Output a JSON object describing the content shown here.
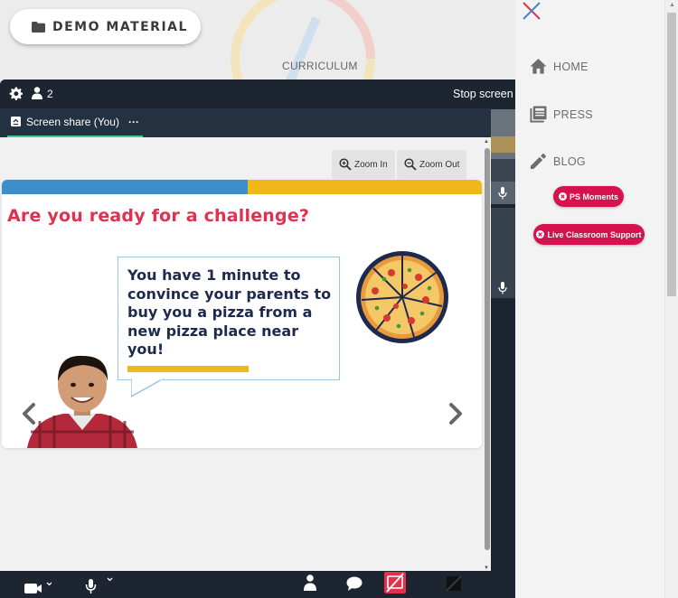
{
  "header": {
    "demo_button_label": "DEMO MATERIAL",
    "section_title": "CURRICULUM",
    "logo_colors": [
      "#f2b71b",
      "#e0314f",
      "#3b8fcb"
    ]
  },
  "meeting": {
    "participant_count": "2",
    "stop_share_label": "Stop screen",
    "tab_label": "Screen share (You)",
    "tab_more": "···",
    "zoom_in_label": "Zoom In",
    "zoom_out_label": "Zoom Out",
    "slide": {
      "title": "Are you ready for a challenge?",
      "bubble_text": "You have 1 minute to convince your parents to buy you a pizza from a new pizza place near you!",
      "colors": {
        "blue": "#3b8fcb",
        "yellow": "#f2b71b",
        "title": "#e0314f",
        "text": "#1d2a4e"
      }
    },
    "bottom_icons": [
      "camera-icon",
      "microphone-icon",
      "participants-icon",
      "chat-icon",
      "share-screen-off-icon",
      "more-icon"
    ]
  },
  "panel": {
    "nav": [
      {
        "label": "HOME",
        "icon": "home-icon"
      },
      {
        "label": "PRESS",
        "icon": "press-icon"
      },
      {
        "label": "BLOG",
        "icon": "pencil-icon"
      }
    ],
    "pills": [
      {
        "label": "PS Moments"
      },
      {
        "label": "Live Classroom Support"
      }
    ],
    "accent": "#d4124e"
  }
}
